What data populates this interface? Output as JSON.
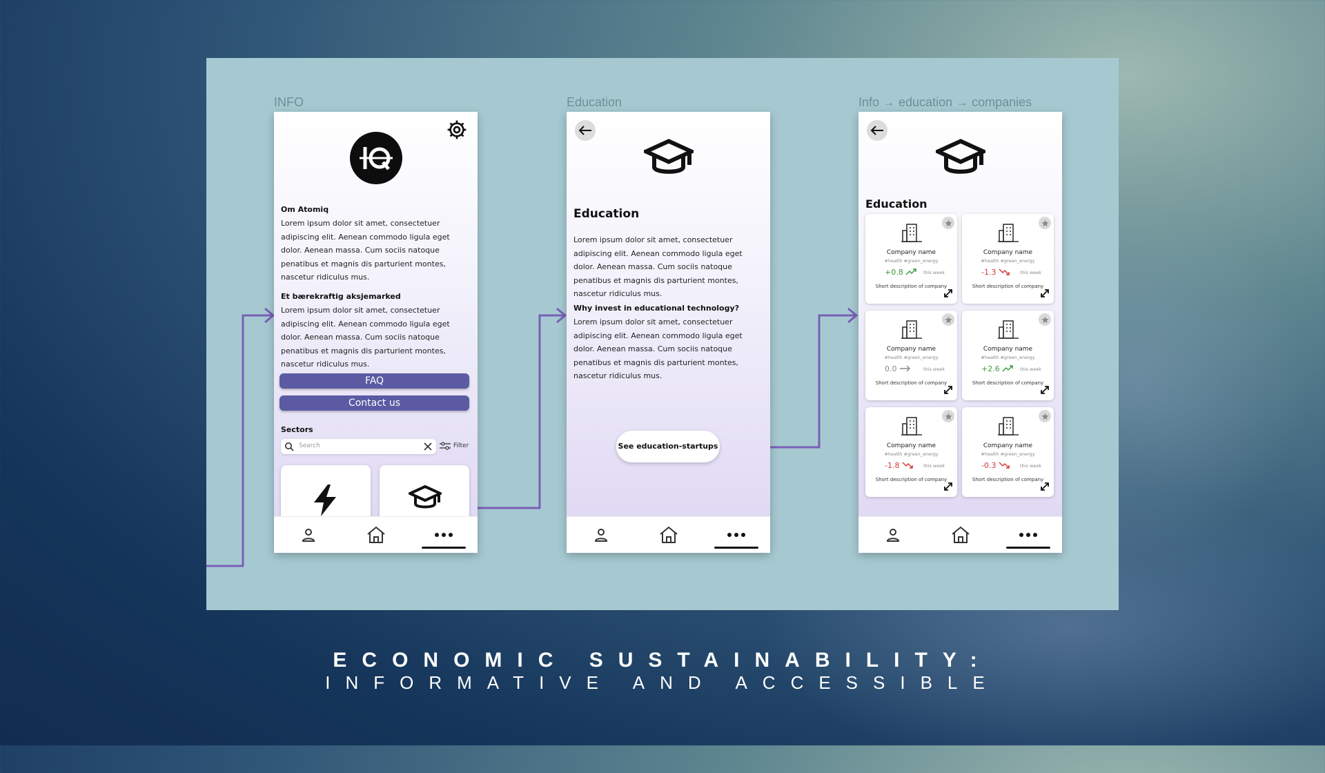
{
  "frames": {
    "info_label": "INFO",
    "education_label": "Education",
    "companies_label": "Info → education → companies"
  },
  "info": {
    "section1_heading": "Om Atomiq",
    "section1_body": "Lorem ipsum dolor sit amet, consectetuer adipiscing elit. Aenean commodo ligula eget dolor. Aenean massa. Cum sociis natoque penatibus et magnis dis parturient montes, nascetur ridiculus mus.",
    "section2_heading": "Et bærekraftig aksjemarked",
    "section2_body": "Lorem ipsum dolor sit amet, consectetuer adipiscing elit. Aenean commodo ligula eget dolor. Aenean massa. Cum sociis natoque penatibus et magnis dis parturient montes, nascetur ridiculus mus.",
    "faq_label": "FAQ",
    "contact_label": "Contact us",
    "sectors_heading": "Sectors",
    "search_placeholder": "Search",
    "filter_label": "Filter"
  },
  "education": {
    "title": "Education",
    "body": "Lorem ipsum dolor sit amet, consectetuer adipiscing elit. Aenean commodo ligula eget dolor. Aenean massa. Cum sociis natoque penatibus et magnis dis parturient montes, nascetur ridiculus mus.",
    "why_heading": "Why invest in educational technology?",
    "why_body": "Lorem ipsum dolor sit amet, consectetuer adipiscing elit. Aenean commodo ligula eget dolor. Aenean massa. Cum sociis natoque penatibus et magnis dis parturient montes, nascetur ridiculus mus.",
    "cta_label": "See education-startups"
  },
  "companies": {
    "title": "Education",
    "cards": [
      {
        "name": "Company name",
        "tags": "#health #green_energy",
        "change": "+0.8",
        "trend": "up",
        "week": "this week",
        "desc": "Short description of company"
      },
      {
        "name": "Company name",
        "tags": "#health #green_energy",
        "change": "-1.3",
        "trend": "down",
        "week": "this week",
        "desc": "Short description of company"
      },
      {
        "name": "Company name",
        "tags": "#health #green_energy",
        "change": "0.0",
        "trend": "flat",
        "week": "this week",
        "desc": "Short description of company"
      },
      {
        "name": "Company name",
        "tags": "#health #green_energy",
        "change": "+2.6",
        "trend": "up",
        "week": "this week",
        "desc": "Short description of company"
      },
      {
        "name": "Company name",
        "tags": "#health #green_energy",
        "change": "-1.8",
        "trend": "down",
        "week": "this week",
        "desc": "Short description of company"
      },
      {
        "name": "Company name",
        "tags": "#health #green_energy",
        "change": "-0.3",
        "trend": "down",
        "week": "this week",
        "desc": "Short description of company"
      }
    ]
  },
  "slide": {
    "title_line1": "ECONOMIC SUSTAINABILITY:",
    "title_line2": "INFORMATIVE AND ACCESSIBLE"
  },
  "colors": {
    "canvas": "#a6c9d1",
    "accent_purple": "#5b5aa3",
    "arrow_purple": "#7a5fb8",
    "positive": "#3c9a3c",
    "negative": "#d23a3a",
    "neutral": "#888888"
  }
}
